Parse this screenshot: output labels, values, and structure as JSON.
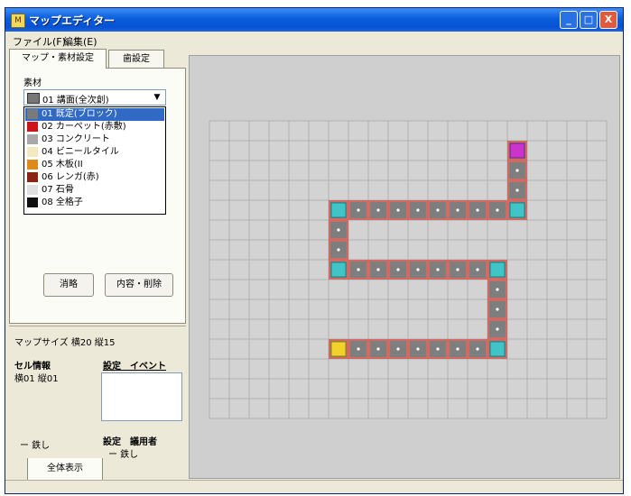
{
  "window": {
    "title": "マップエディター",
    "min_symbol": "_",
    "max_symbol": "□",
    "close_symbol": "X"
  },
  "menu": {
    "file": "ファイル(F)",
    "edit": "編集(E)"
  },
  "tabs": {
    "map_settings": "マップ・素材設定",
    "other": "歯設定"
  },
  "panel": {
    "material_label": "素材",
    "combo_value": "01 講面(全次創)",
    "combo_arrow": "▼",
    "dropdown": [
      {
        "label": "01 既定(ブロック)",
        "color": "#7a7a7a",
        "selected": true
      },
      {
        "label": "02 カーペット(赤敷)",
        "color": "#d0121a",
        "selected": false
      },
      {
        "label": "03 コンクリート",
        "color": "#a8a8a8",
        "selected": false
      },
      {
        "label": "04 ビニールタイル",
        "color": "#f4e8c0",
        "selected": false
      },
      {
        "label": "05 木板(II",
        "color": "#e08a1c",
        "selected": false
      },
      {
        "label": "06 レンガ(赤)",
        "color": "#8a2410",
        "selected": false
      },
      {
        "label": "07 石骨",
        "color": "#e0e0e0",
        "selected": false
      },
      {
        "label": "08 全格子",
        "color": "#101010",
        "selected": false
      }
    ],
    "btn_left": "消略",
    "btn_right": "内容・削除",
    "map_size": "マップサイズ 横20 縦15",
    "cell_info_label": "セル情報",
    "cell_coord": "横01 縦01",
    "setting_event_header": "設定　イベント",
    "dash_none": "ー 鉄し",
    "setting_owner": "設定　議用者",
    "setting_owner_val": "ー 鉄し",
    "full_view": "全体表示"
  },
  "grid": {
    "cols": 20,
    "rows": 15,
    "bg_color": "#d3d3d3",
    "line_color": "#b0b0b0"
  },
  "track": {
    "path": [
      [
        15,
        1
      ],
      [
        15,
        4
      ],
      [
        6,
        4
      ],
      [
        6,
        7
      ],
      [
        14,
        7
      ],
      [
        14,
        11
      ],
      [
        6,
        11
      ]
    ],
    "fill_color": "#7e7e7e",
    "border_color": "#cf6b62",
    "start_cell": [
      6,
      11
    ],
    "end_cell": [
      15,
      1
    ],
    "start_color": "#f2d22a",
    "end_color": "#cc33cc",
    "corner_color": "#40c4c8"
  }
}
